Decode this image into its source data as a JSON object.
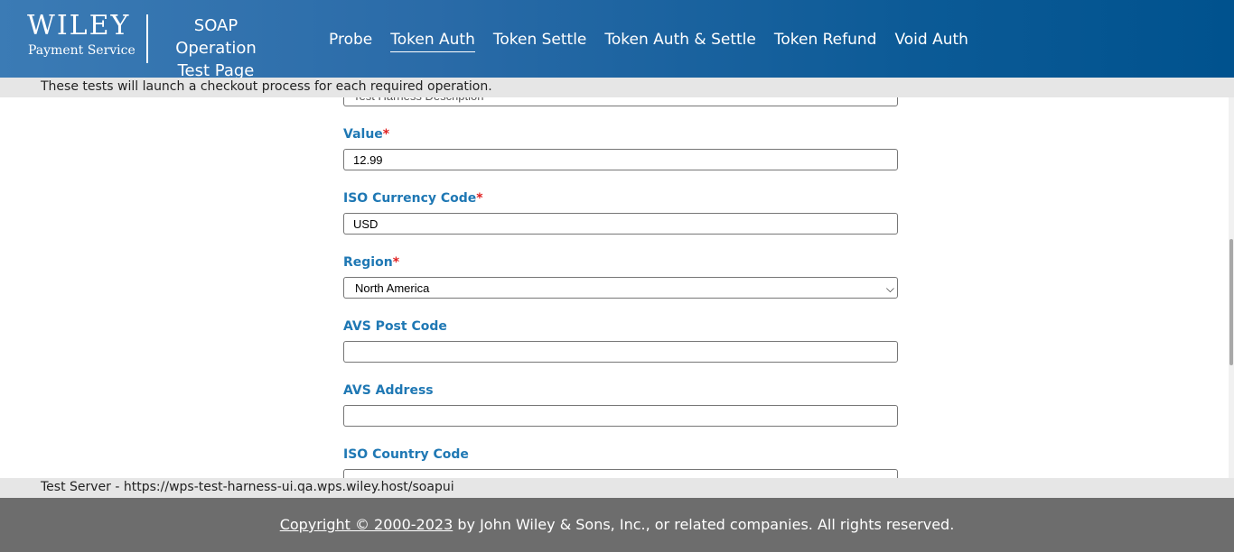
{
  "header": {
    "logo_word": "WILEY",
    "logo_sub": "Payment Service",
    "title_line1": "SOAP Operation",
    "title_line2": "Test Page"
  },
  "nav": {
    "items": [
      {
        "label": "Probe",
        "active": false
      },
      {
        "label": "Token Auth",
        "active": true
      },
      {
        "label": "Token Settle",
        "active": false
      },
      {
        "label": "Token Auth & Settle",
        "active": false
      },
      {
        "label": "Token Refund",
        "active": false
      },
      {
        "label": "Void Auth",
        "active": false
      }
    ]
  },
  "info_bar": {
    "text": "These tests will launch a checkout process for each required operation."
  },
  "form": {
    "description_stub": "Test Harness Description",
    "value": {
      "label": "Value",
      "required_mark": "*",
      "value": "12.99"
    },
    "currency": {
      "label": "ISO Currency Code",
      "required_mark": "*",
      "value": "USD"
    },
    "region": {
      "label": "Region",
      "required_mark": "*",
      "selected": "North America"
    },
    "avs_post_code": {
      "label": "AVS Post Code",
      "value": ""
    },
    "avs_address": {
      "label": "AVS Address",
      "value": ""
    },
    "iso_country_code": {
      "label": "ISO Country Code",
      "value": ""
    }
  },
  "server_bar": {
    "text": "Test Server - https://wps-test-harness-ui.qa.wps.wiley.host/soapui"
  },
  "footer": {
    "copyright_link": "Copyright © 2000-2023",
    "rest": " by John Wiley & Sons, Inc., or related companies. All rights reserved."
  },
  "colors": {
    "header_start": "#3b7bb5",
    "header_end": "#00528e",
    "label_blue": "#1f78b4",
    "required_red": "#e02020",
    "footer_gray": "#6d6d6d"
  }
}
